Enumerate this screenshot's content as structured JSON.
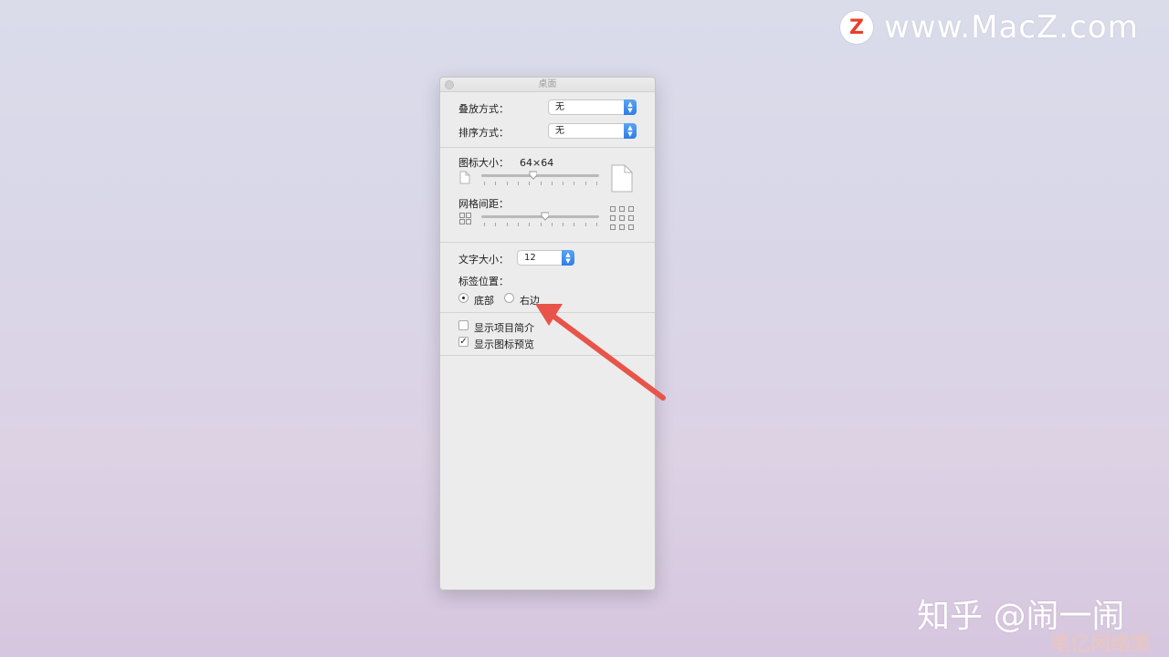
{
  "watermark": {
    "top_logo_letter": "Z",
    "top_text": "www.MacZ.com",
    "bottom_text": "知乎 @闹一闹",
    "bottom_text2": "笔亿网络策划"
  },
  "panel": {
    "title": "桌面",
    "stack_by": {
      "label": "叠放方式：",
      "value": "无"
    },
    "sort_by": {
      "label": "排序方式：",
      "value": "无"
    },
    "icon_size": {
      "label": "图标大小：",
      "value": "64×64",
      "slider_position": 0.44
    },
    "grid_spacing": {
      "label": "网格间距：",
      "slider_position": 0.54
    },
    "text_size": {
      "label": "文字大小：",
      "value": "12"
    },
    "label_position": {
      "label": "标签位置：",
      "options": [
        {
          "label": "底部",
          "selected": true
        },
        {
          "label": "右边",
          "selected": false
        }
      ]
    },
    "checkboxes": [
      {
        "label": "显示项目简介",
        "checked": false
      },
      {
        "label": "显示图标预览",
        "checked": true
      }
    ]
  },
  "colors": {
    "accent": "#3b86ee",
    "arrow": "#e8544a"
  }
}
